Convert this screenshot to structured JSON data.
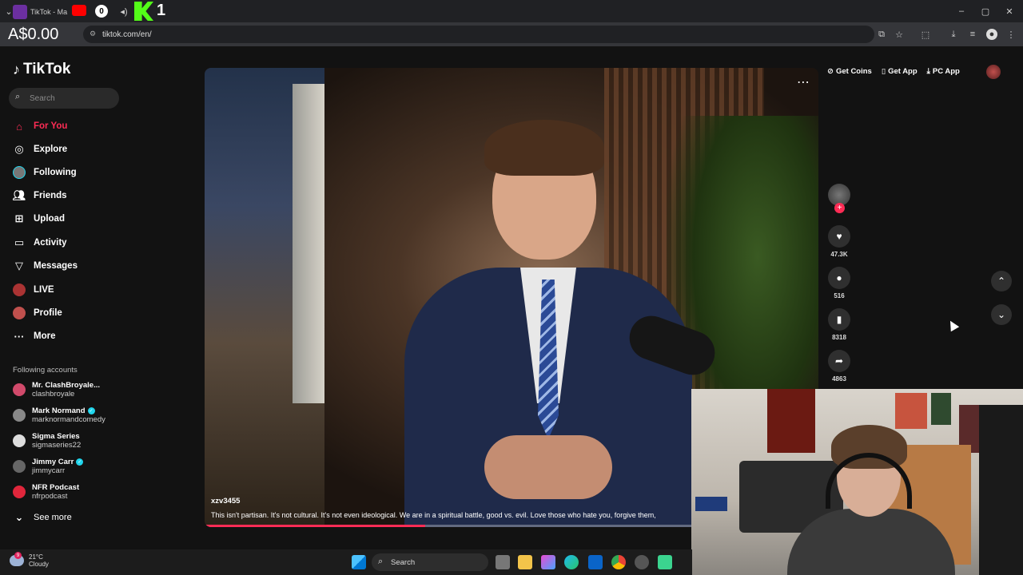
{
  "browser": {
    "tabs": [
      {
        "label": "TikTok - Ma"
      }
    ],
    "balance": "A$0.00",
    "url": "tiktok.com/en/",
    "window_controls": [
      "minimize",
      "restore",
      "close"
    ]
  },
  "sidebar": {
    "logo": "TikTok",
    "search_placeholder": "Search",
    "nav": [
      {
        "label": "For You",
        "icon": "home-icon",
        "active": true
      },
      {
        "label": "Explore",
        "icon": "compass-icon"
      },
      {
        "label": "Following",
        "icon": "following-avatar-icon"
      },
      {
        "label": "Friends",
        "icon": "friends-icon"
      },
      {
        "label": "Upload",
        "icon": "plus-square-icon"
      },
      {
        "label": "Activity",
        "icon": "inbox-icon"
      },
      {
        "label": "Messages",
        "icon": "send-icon"
      },
      {
        "label": "LIVE",
        "icon": "live-avatar-icon"
      },
      {
        "label": "Profile",
        "icon": "profile-avatar-icon"
      },
      {
        "label": "More",
        "icon": "more-dots-icon"
      }
    ],
    "following_header": "Following accounts",
    "accounts": [
      {
        "name": "Mr. ClashBroyale...",
        "handle": "clashbroyale",
        "verified": false
      },
      {
        "name": "Mark Normand",
        "handle": "marknormandcomedy",
        "verified": true
      },
      {
        "name": "Sigma Series",
        "handle": "sigmaseries22",
        "verified": false
      },
      {
        "name": "Jimmy Carr",
        "handle": "jimmycarr",
        "verified": true
      },
      {
        "name": "NFR Podcast",
        "handle": "nfrpodcast",
        "verified": false
      }
    ],
    "see_more": "See more"
  },
  "top_actions": {
    "get_coins": "Get Coins",
    "get_app": "Get App",
    "pc_app": "PC App"
  },
  "video": {
    "username": "xzv3455",
    "caption": "This isn't partisan. It's not cultural. It's not even ideological. We are in a spiritual battle, good vs. evil. Love those who hate you, forgive them,",
    "progress_percent": 36
  },
  "actions": {
    "likes": "47.3K",
    "comments": "516",
    "bookmarks": "8318",
    "shares": "4863"
  },
  "taskbar": {
    "temperature": "21°C",
    "condition": "Cloudy",
    "search_label": "Search",
    "weather_badge": "9"
  },
  "colors": {
    "accent": "#fe2c55",
    "background": "#121212",
    "verified": "#20d5ec"
  }
}
